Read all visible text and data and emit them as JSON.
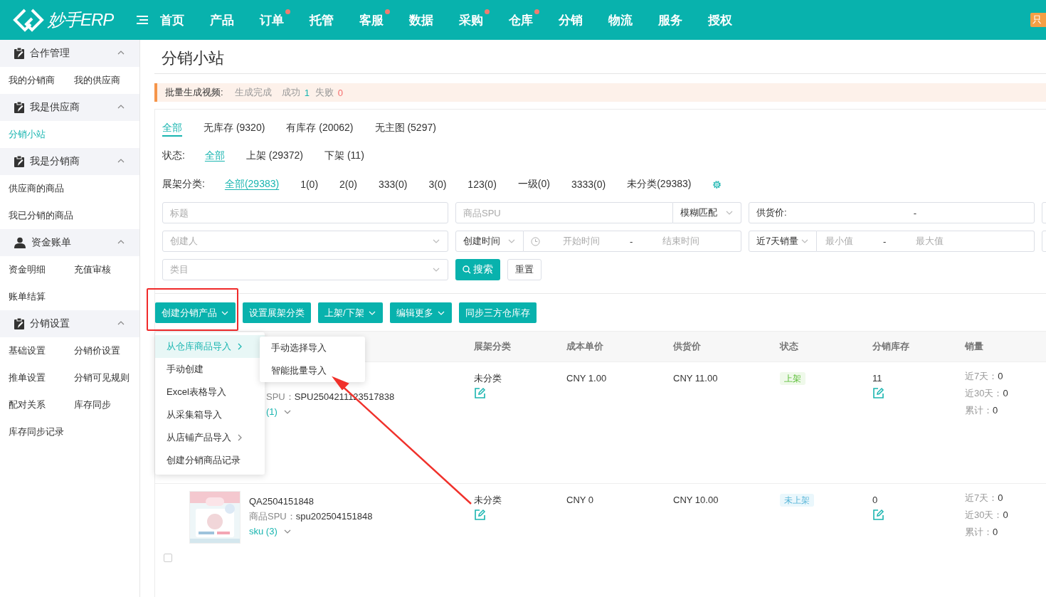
{
  "top_bar": {
    "logo": "妙手ERP",
    "nav": [
      {
        "label": "首页",
        "dot": false
      },
      {
        "label": "产品",
        "dot": false
      },
      {
        "label": "订单",
        "dot": true
      },
      {
        "label": "托管",
        "dot": false
      },
      {
        "label": "客服",
        "dot": true
      },
      {
        "label": "数据",
        "dot": false
      },
      {
        "label": "采购",
        "dot": true
      },
      {
        "label": "仓库",
        "dot": true
      },
      {
        "label": "分销",
        "dot": false
      },
      {
        "label": "物流",
        "dot": false
      },
      {
        "label": "服务",
        "dot": false
      },
      {
        "label": "授权",
        "dot": false
      }
    ],
    "badge": "只"
  },
  "sidebar": {
    "groups": [
      {
        "title": "合作管理",
        "kind": "clipboard",
        "expanded": true,
        "rows": [
          [
            {
              "label": "我的分销商",
              "selected": false
            },
            {
              "label": "我的供应商",
              "selected": false
            }
          ]
        ]
      },
      {
        "title": "我是供应商",
        "kind": "clipboard",
        "expanded": true,
        "rows": [
          [
            {
              "label": "分销小站",
              "selected": true
            }
          ]
        ]
      },
      {
        "title": "我是分销商",
        "kind": "clipboard",
        "expanded": true,
        "rows": [
          [
            {
              "label": "供应商的商品",
              "selected": false
            }
          ],
          [
            {
              "label": "我已分销的商品",
              "selected": false
            }
          ]
        ]
      },
      {
        "title": "资金账单",
        "kind": "person",
        "expanded": true,
        "rows": [
          [
            {
              "label": "资金明细",
              "selected": false
            },
            {
              "label": "充值审核",
              "selected": false
            }
          ],
          [
            {
              "label": "账单结算",
              "selected": false
            }
          ]
        ]
      },
      {
        "title": "分销设置",
        "kind": "clipboard",
        "expanded": true,
        "rows": [
          [
            {
              "label": "基础设置",
              "selected": false
            },
            {
              "label": "分销价设置",
              "selected": false
            }
          ],
          [
            {
              "label": "推单设置",
              "selected": false
            },
            {
              "label": "分销可见规则",
              "selected": false
            }
          ],
          [
            {
              "label": "配对关系",
              "selected": false
            },
            {
              "label": "库存同步",
              "selected": false
            }
          ],
          [
            {
              "label": "库存同步记录",
              "selected": false
            }
          ]
        ]
      }
    ]
  },
  "page_title": "分销小站",
  "notice": {
    "label": "批量生成视频:",
    "status": "生成完成",
    "success_label": "成功",
    "success_count": "1",
    "fail_label": "失败",
    "fail_count": "0"
  },
  "stock_tabs": [
    {
      "label": "全部",
      "selected": true
    },
    {
      "label": "无库存 (9320)",
      "selected": false
    },
    {
      "label": "有库存 (20062)",
      "selected": false
    },
    {
      "label": "无主图 (5297)",
      "selected": false
    }
  ],
  "status_filter": {
    "label": "状态:",
    "options": [
      {
        "label": "全部",
        "selected": true
      },
      {
        "label": "上架 (29372)",
        "selected": false
      },
      {
        "label": "下架 (11)",
        "selected": false
      }
    ]
  },
  "shelf_filter": {
    "label": "展架分类:",
    "options": [
      {
        "label": "全部(29383)",
        "selected": true
      },
      {
        "label": "1(0)",
        "selected": false
      },
      {
        "label": "2(0)",
        "selected": false
      },
      {
        "label": "333(0)",
        "selected": false
      },
      {
        "label": "3(0)",
        "selected": false
      },
      {
        "label": "123(0)",
        "selected": false
      },
      {
        "label": "一级(0)",
        "selected": false
      },
      {
        "label": "3333(0)",
        "selected": false
      },
      {
        "label": "未分类(29383)",
        "selected": false
      }
    ]
  },
  "filters": [
    [
      {
        "kind": "input",
        "placeholder": "标题"
      },
      {
        "kind": "select_after",
        "placeholder": "商品SPU",
        "select": "模糊匹配"
      },
      {
        "kind": "range",
        "label": "供货价:",
        "separator": "-"
      },
      {
        "kind": "cut_off"
      }
    ],
    [
      {
        "kind": "select",
        "placeholder": "创建人"
      },
      {
        "kind": "date_range",
        "select": "创建时间",
        "start": "开始时间",
        "separator": "-",
        "end": "结束时间"
      },
      {
        "kind": "select_range",
        "select": "近7天销量",
        "start": "最小值",
        "separator": "-",
        "end": "最大值"
      },
      {
        "kind": "cut_off"
      }
    ],
    [
      {
        "kind": "select",
        "placeholder": "类目"
      },
      {
        "kind": "buttons",
        "search": "搜索",
        "reset": "重置"
      }
    ]
  ],
  "actions": [
    {
      "label": "创建分销产品",
      "caret": true,
      "highlighted": true
    },
    {
      "label": "设置展架分类",
      "caret": false,
      "highlighted": false
    },
    {
      "label": "上架/下架",
      "caret": true,
      "highlighted": false
    },
    {
      "label": "编辑更多",
      "caret": true,
      "highlighted": false
    },
    {
      "label": "同步三方仓库存",
      "caret": false,
      "highlighted": false
    }
  ],
  "create_menu": {
    "items": [
      {
        "label": "从仓库商品导入",
        "submenu": true,
        "selected": true
      },
      {
        "label": "手动创建",
        "submenu": false,
        "selected": false
      },
      {
        "label": "Excel表格导入",
        "submenu": false,
        "selected": false
      },
      {
        "label": "从采集箱导入",
        "submenu": false,
        "selected": false
      },
      {
        "label": "从店铺产品导入",
        "submenu": true,
        "selected": false
      },
      {
        "label": "创建分销商品记录",
        "submenu": false,
        "selected": false
      }
    ],
    "submenu": [
      "手动选择导入",
      "智能批量导入"
    ],
    "pointer_arrow": true
  },
  "table": {
    "columns": [
      "展架分类",
      "成本单价",
      "供货价",
      "状态",
      "分销库存",
      "销量"
    ],
    "rows": [
      {
        "covered": true,
        "spu_label": "SPU：",
        "spu": "SPU2504211123517838",
        "sku": "(1)",
        "category": "未分类",
        "cost": "CNY 1.00",
        "supply": "CNY 11.00",
        "status": {
          "text": "上架",
          "kind": "on"
        },
        "stock": "11",
        "sales": [
          {
            "label": "近7天：",
            "value": "0"
          },
          {
            "label": "近30天：",
            "value": "0"
          },
          {
            "label": "累计：",
            "value": "0"
          }
        ]
      },
      {
        "covered": false,
        "checked": false,
        "title": "QA2504151848",
        "spu_label": "商品SPU：",
        "spu": "spu202504151848",
        "sku": "sku (3)",
        "category": "未分类",
        "cost": "CNY 0",
        "supply": "CNY 10.00",
        "status": {
          "text": "未上架",
          "kind": "off"
        },
        "stock": "0",
        "sales": [
          {
            "label": "近7天：",
            "value": "0"
          },
          {
            "label": "近30天：",
            "value": "0"
          },
          {
            "label": "累计：",
            "value": "0"
          }
        ]
      }
    ]
  }
}
